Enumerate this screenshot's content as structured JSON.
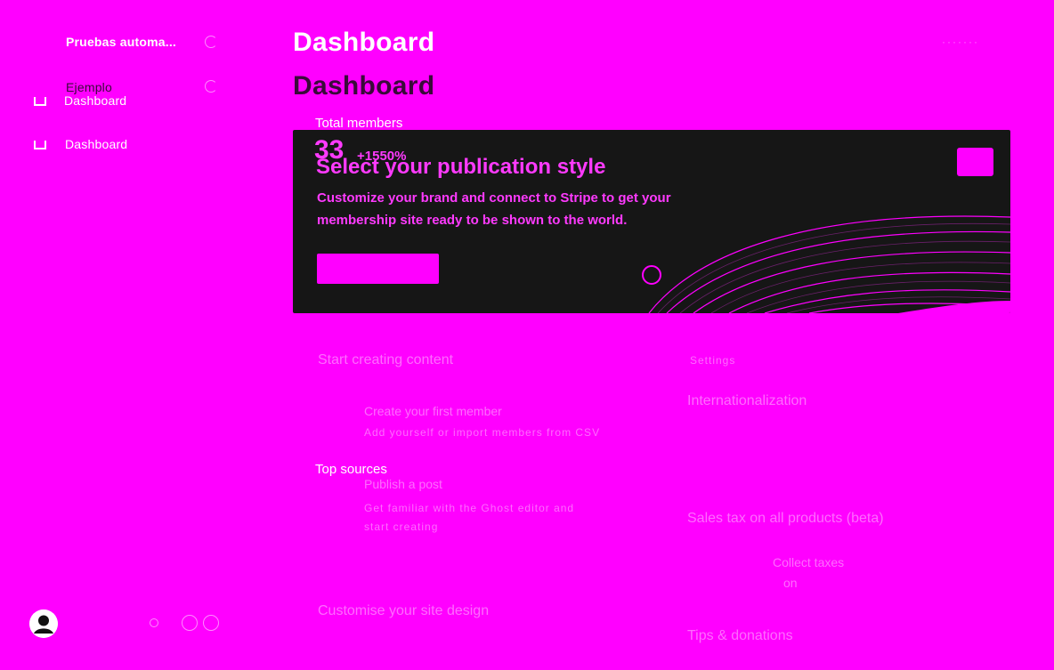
{
  "sidebar": {
    "workspace": "Pruebas automa...",
    "items": [
      {
        "line1": "Ejemplo",
        "line2": "Dashboard"
      },
      {
        "line1": "Dashboard"
      }
    ]
  },
  "header": {
    "title": "Dashboard",
    "subtitle": "Dashboard"
  },
  "stats": {
    "total_members_label": "Total members",
    "total_members_value": "33",
    "total_members_change": "+1550%"
  },
  "banner": {
    "title": "Select your publication style",
    "description": "Customize your brand and connect to Stripe to get your membership site ready to be shown to the world.",
    "cta_label": ""
  },
  "getting_started": {
    "title": "Start creating content",
    "tasks": [
      {
        "title": "Create your first member",
        "description": "Add yourself or import members from CSV"
      },
      {
        "title": "Publish a post",
        "description": "Get familiar with the Ghost editor and start creating"
      }
    ],
    "design_title": "Customise your site design"
  },
  "top_sources_label": "Top sources",
  "settings": {
    "label": "Settings",
    "internationalization": "Internationalization",
    "sales_tax": "Sales tax on all products (beta)",
    "sales_tax_detail_line1": "Collect taxes",
    "sales_tax_detail_line2": "on",
    "tips_donations": "Tips & donations"
  },
  "colors": {
    "background": "#ff00ff",
    "banner": "#161616",
    "accent": "#ff3aff"
  }
}
